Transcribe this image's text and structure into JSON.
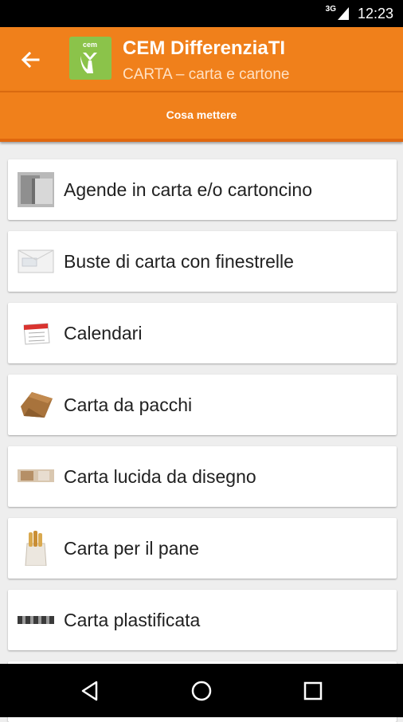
{
  "status_bar": {
    "network": "3G",
    "time": "12:23"
  },
  "app_bar": {
    "logo_text": "cem",
    "title": "CEM DifferenziaTI",
    "subtitle": "CARTA – carta e cartone"
  },
  "tabs": [
    {
      "label": "Cosa mettere"
    }
  ],
  "items": [
    {
      "label": "Agende in carta e/o cartoncino",
      "icon": "agenda-icon"
    },
    {
      "label": "Buste di carta con finestrelle",
      "icon": "envelope-icon"
    },
    {
      "label": "Calendari",
      "icon": "calendar-icon"
    },
    {
      "label": "Carta da pacchi",
      "icon": "packing-paper-icon"
    },
    {
      "label": "Carta lucida da disegno",
      "icon": "tracing-paper-icon"
    },
    {
      "label": "Carta per il pane",
      "icon": "bread-bag-icon"
    },
    {
      "label": "Carta plastificata",
      "icon": "laminated-paper-icon"
    }
  ],
  "colors": {
    "accent": "#f0801b",
    "logo": "#8bc34a"
  }
}
